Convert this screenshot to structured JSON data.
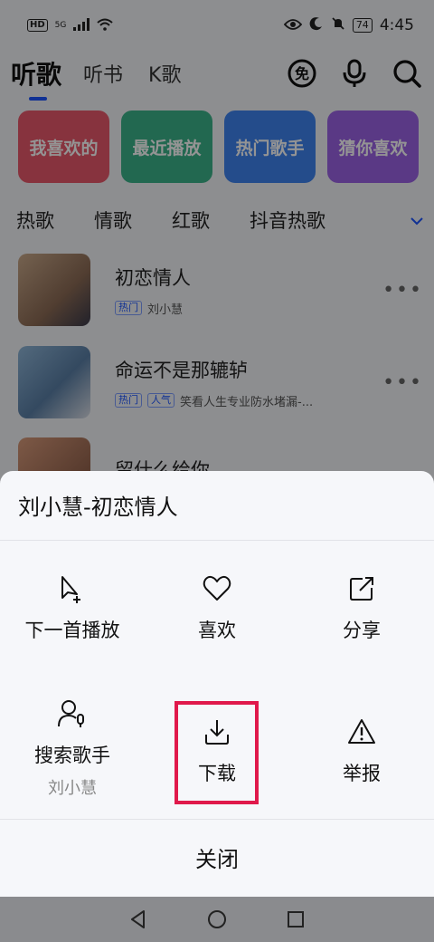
{
  "status": {
    "hd": "HD",
    "signal": "5G",
    "battery": "74",
    "time": "4:45"
  },
  "header": {
    "tabs": [
      "听歌",
      "听书",
      "K歌"
    ],
    "free_icon_label": "免"
  },
  "categories": [
    {
      "label": "我喜欢的",
      "color": "#e8596b"
    },
    {
      "label": "最近播放",
      "color": "#3cb38a"
    },
    {
      "label": "热门歌手",
      "color": "#3f84f0"
    },
    {
      "label": "猜你喜欢",
      "color": "#9c63e6"
    }
  ],
  "genres": [
    "热歌",
    "情歌",
    "红歌",
    "抖音热歌"
  ],
  "songs": [
    {
      "title": "初恋情人",
      "badges": [
        "热门"
      ],
      "artist": "刘小慧"
    },
    {
      "title": "命运不是那辘轳",
      "badges": [
        "热门",
        "人气"
      ],
      "artist": "笑看人生专业防水堵漏-..."
    },
    {
      "title": "留什么给你",
      "badges": [],
      "artist": ""
    }
  ],
  "sheet": {
    "title": "刘小慧-初恋情人",
    "actions": [
      {
        "label": "下一首播放",
        "icon": "play-next-icon"
      },
      {
        "label": "喜欢",
        "icon": "heart-icon"
      },
      {
        "label": "分享",
        "icon": "share-icon"
      },
      {
        "label": "搜索歌手",
        "sub": "刘小慧",
        "icon": "search-singer-icon"
      },
      {
        "label": "下载",
        "icon": "download-icon"
      },
      {
        "label": "举报",
        "icon": "report-icon"
      }
    ],
    "close_label": "关闭"
  }
}
